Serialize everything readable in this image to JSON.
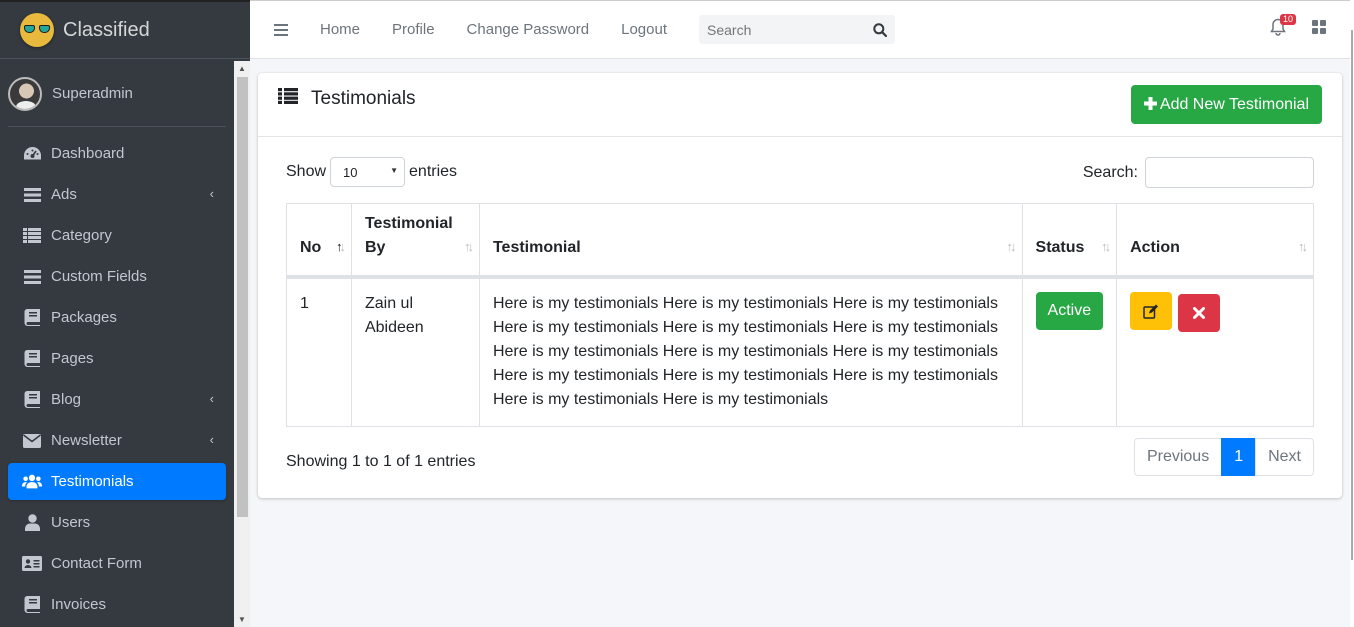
{
  "brand": {
    "name": "Classified",
    "logo_icon": "sunglasses-face-logo"
  },
  "user": {
    "name": "Superadmin",
    "avatar_icon": "user-avatar"
  },
  "sidebar": {
    "items": [
      {
        "label": "Dashboard",
        "icon": "tachometer-icon",
        "arrow": ""
      },
      {
        "label": "Ads",
        "icon": "bars-icon",
        "arrow": "‹"
      },
      {
        "label": "Category",
        "icon": "list-icon",
        "arrow": ""
      },
      {
        "label": "Custom Fields",
        "icon": "bars-icon",
        "arrow": ""
      },
      {
        "label": "Packages",
        "icon": "book-icon",
        "arrow": ""
      },
      {
        "label": "Pages",
        "icon": "book-icon",
        "arrow": ""
      },
      {
        "label": "Blog",
        "icon": "book-icon",
        "arrow": "‹"
      },
      {
        "label": "Newsletter",
        "icon": "envelope-icon",
        "arrow": "‹"
      },
      {
        "label": "Testimonials",
        "icon": "users-icon",
        "arrow": ""
      },
      {
        "label": "Users",
        "icon": "user-icon",
        "arrow": ""
      },
      {
        "label": "Contact Form",
        "icon": "address-card-icon",
        "arrow": ""
      },
      {
        "label": "Invoices",
        "icon": "book-icon",
        "arrow": ""
      }
    ],
    "active_index": 8
  },
  "topbar": {
    "links": [
      "Home",
      "Profile",
      "Change Password",
      "Logout"
    ],
    "search_placeholder": "Search",
    "notification_count": "10"
  },
  "card": {
    "title": "Testimonials",
    "add_button": "Add New Testimonial",
    "show_label": "Show",
    "entries_value": "10",
    "entries_label": "entries",
    "search_label": "Search:",
    "columns": [
      "No",
      "Testimonial By",
      "Testimonial",
      "Status",
      "Action"
    ],
    "rows": [
      {
        "no": "1",
        "by": "Zain ul Abideen",
        "testimonial": "Here is my testimonials Here is my testimonials Here is my testimonials Here is my testimonials Here is my testimonials Here is my testimonials Here is my testimonials Here is my testimonials Here is my testimonials Here is my testimonials Here is my testimonials Here is my testimonials Here is my testimonials Here is my testimonials",
        "status": "Active"
      }
    ],
    "info": "Showing 1 to 1 of 1 entries",
    "pagination": {
      "previous": "Previous",
      "current": "1",
      "next": "Next"
    }
  },
  "colors": {
    "sidebar_bg": "#343a40",
    "active": "#007bff",
    "success": "#28a745",
    "warning": "#ffc107",
    "danger": "#dc3545"
  }
}
